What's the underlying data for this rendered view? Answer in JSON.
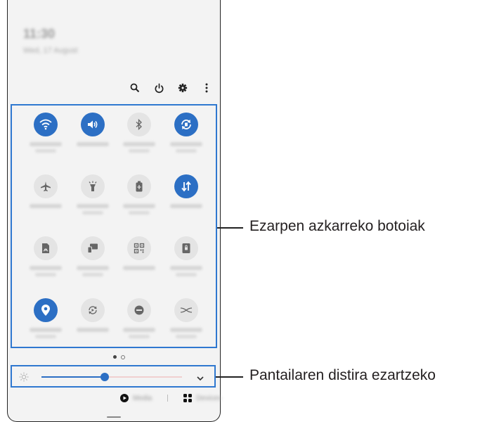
{
  "status": {
    "time": "11:30",
    "date": "Wed, 17 August"
  },
  "header": {
    "icons": [
      {
        "name": "search-icon"
      },
      {
        "name": "power-icon"
      },
      {
        "name": "gear-icon"
      },
      {
        "name": "more-vertical-icon"
      }
    ]
  },
  "quick_settings": {
    "tiles": [
      {
        "icon": "wifi-icon",
        "on": true
      },
      {
        "icon": "sound-icon",
        "on": true
      },
      {
        "icon": "bluetooth-icon",
        "on": false
      },
      {
        "icon": "auto-rotate-icon",
        "on": true
      },
      {
        "icon": "airplane-icon",
        "on": false
      },
      {
        "icon": "flashlight-icon",
        "on": false
      },
      {
        "icon": "battery-saver-icon",
        "on": false
      },
      {
        "icon": "mobile-data-icon",
        "on": true
      },
      {
        "icon": "nfc-icon",
        "on": false
      },
      {
        "icon": "smart-view-icon",
        "on": false
      },
      {
        "icon": "qr-scanner-icon",
        "on": false
      },
      {
        "icon": "secure-folder-icon",
        "on": false
      },
      {
        "icon": "location-icon",
        "on": true
      },
      {
        "icon": "sync-icon",
        "on": false
      },
      {
        "icon": "do-not-disturb-icon",
        "on": false
      },
      {
        "icon": "hotspot-icon",
        "on": false
      }
    ]
  },
  "pager": {
    "pages": 2,
    "current": 1
  },
  "brightness": {
    "level": 0.45
  },
  "bottom": {
    "media_label": "Media",
    "devices_label": "Devices"
  },
  "callouts": {
    "quick_buttons": "Ezarpen azkarreko botoiak",
    "brightness": "Pantailaren distira ezartzeko"
  },
  "colors": {
    "accent": "#2c6fc4",
    "highlight": "#2f78d0"
  }
}
